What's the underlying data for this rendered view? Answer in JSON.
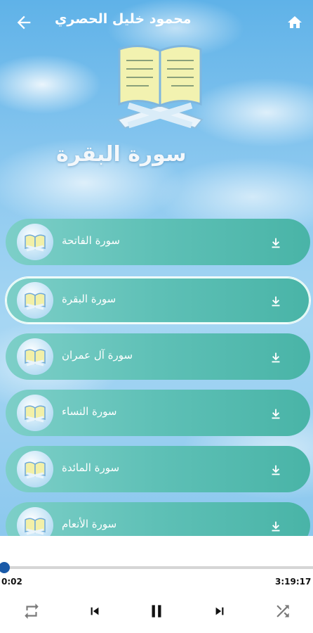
{
  "header": {
    "title": "محمود خليل الحصري",
    "back_icon": "arrow-left-icon",
    "home_icon": "home-icon"
  },
  "now_playing": {
    "title": "سورة البقرة"
  },
  "surah_list": [
    {
      "name": "سورة الفاتحة",
      "selected": false
    },
    {
      "name": "سورة البقرة",
      "selected": true
    },
    {
      "name": "سورة آل عمران",
      "selected": false
    },
    {
      "name": "سورة النساء",
      "selected": false
    },
    {
      "name": "سورة المائدة",
      "selected": false
    },
    {
      "name": "سورة الأنعام",
      "selected": false
    }
  ],
  "player": {
    "elapsed": "0:02",
    "duration": "3:19:17",
    "progress_fraction": 0.0002,
    "controls": [
      "repeat-icon",
      "skip-previous-icon",
      "pause-icon",
      "skip-next-icon",
      "shuffle-icon"
    ]
  },
  "colors": {
    "accent": "#1a5aa8",
    "list_item": "#5ec0b6"
  }
}
